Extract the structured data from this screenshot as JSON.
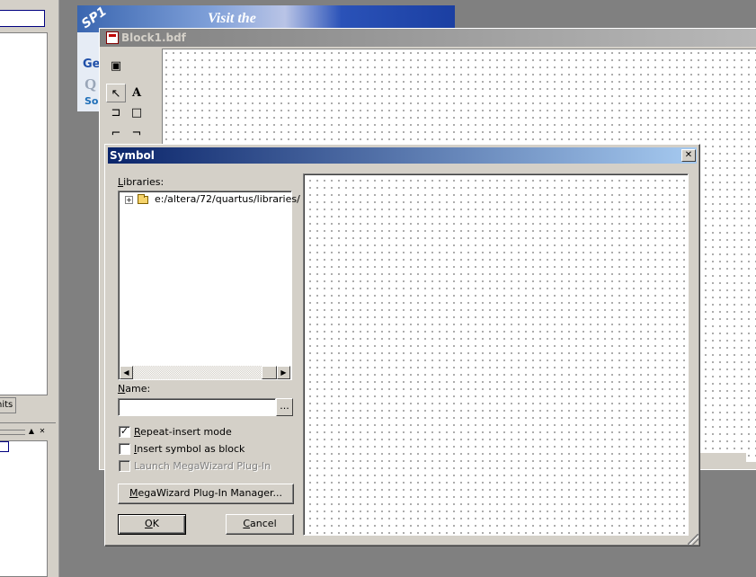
{
  "left_panel": {
    "tab_label": "nits"
  },
  "banner": {
    "badge": "SP1",
    "headline": "Visit the",
    "line1": "Get",
    "line2": "Q",
    "line3": "So"
  },
  "bdf_window": {
    "title": "Block1.bdf",
    "tools": [
      {
        "icon": "window-icon",
        "glyph": "▣"
      },
      {
        "icon": "pointer-icon",
        "glyph": "↖"
      },
      {
        "icon": "text-tool-icon",
        "glyph": "A"
      },
      {
        "icon": "symbol-tool-icon",
        "glyph": "⊐"
      },
      {
        "icon": "block-tool-icon",
        "glyph": "□"
      },
      {
        "icon": "orthogonal-node-icon",
        "glyph": "⌐"
      },
      {
        "icon": "orthogonal-bus-icon",
        "glyph": "¬"
      }
    ]
  },
  "dialog": {
    "title": "Symbol",
    "close_glyph": "✕",
    "libraries_label": "Libraries:",
    "libraries_accel": "L",
    "libraries_rest": "ibraries:",
    "tree_root": "e:/altera/72/quartus/libraries/",
    "name_accel": "N",
    "name_rest": "ame:",
    "name_value": "",
    "browse_label": "...",
    "options": [
      {
        "accel": "R",
        "rest": "epeat-insert mode",
        "checked": true,
        "enabled": true
      },
      {
        "accel": "I",
        "rest": "nsert symbol as block",
        "checked": false,
        "enabled": true
      },
      {
        "accel": "",
        "rest": "Launch MegaWizard Plug-In",
        "checked": false,
        "enabled": false
      }
    ],
    "megawizard_accel": "M",
    "megawizard_rest": "egaWizard Plug-In Manager...",
    "ok_accel": "O",
    "ok_rest": "K",
    "cancel_accel": "C",
    "cancel_rest": "ancel"
  }
}
